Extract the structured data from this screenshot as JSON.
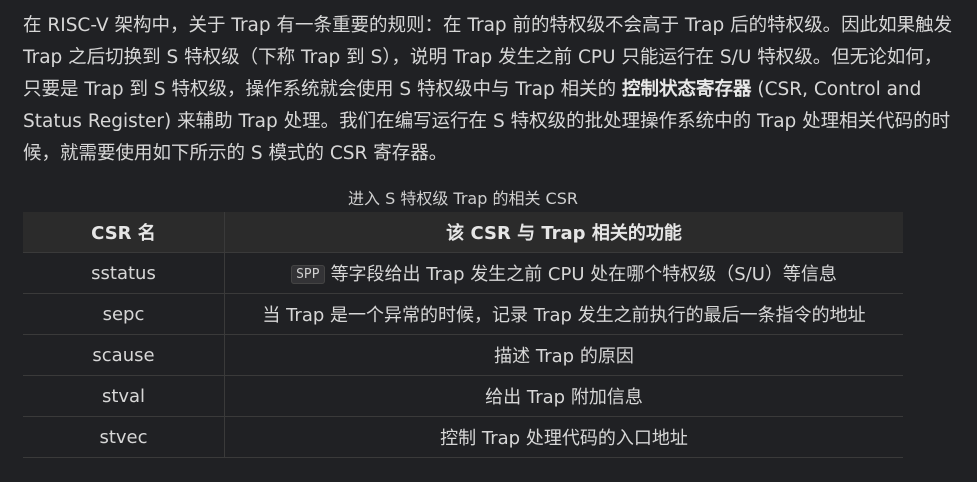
{
  "paragraph": {
    "part1": "在 RISC-V 架构中，关于 Trap 有一条重要的规则：在 Trap 前的特权级不会高于 Trap 后的特权级。因此如果触发 Trap 之后切换到 S 特权级（下称 Trap 到 S），说明 Trap 发生之前 CPU 只能运行在 S/U 特权级。但无论如何，只要是 Trap 到 S 特权级，操作系统就会使用 S 特权级中与 Trap 相关的 ",
    "bold": "控制状态寄存器",
    "part2": " (CSR, Control and Status Register) 来辅助 Trap 处理。我们在编写运行在 S 特权级的批处理操作系统中的 Trap 处理相关代码的时候，就需要使用如下所示的 S 模式的 CSR 寄存器。"
  },
  "table": {
    "caption": "进入 S 特权级 Trap 的相关 CSR",
    "headers": [
      "CSR 名",
      "该 CSR 与 Trap 相关的功能"
    ],
    "rows": [
      {
        "name": "sstatus",
        "code": "SPP",
        "desc": "等字段给出 Trap 发生之前 CPU 处在哪个特权级（S/U）等信息"
      },
      {
        "name": "sepc",
        "desc": "当 Trap 是一个异常的时候，记录 Trap 发生之前执行的最后一条指令的地址"
      },
      {
        "name": "scause",
        "desc": "描述 Trap 的原因"
      },
      {
        "name": "stval",
        "desc": "给出 Trap 附加信息"
      },
      {
        "name": "stvec",
        "desc": "控制 Trap 处理代码的入口地址"
      }
    ]
  }
}
